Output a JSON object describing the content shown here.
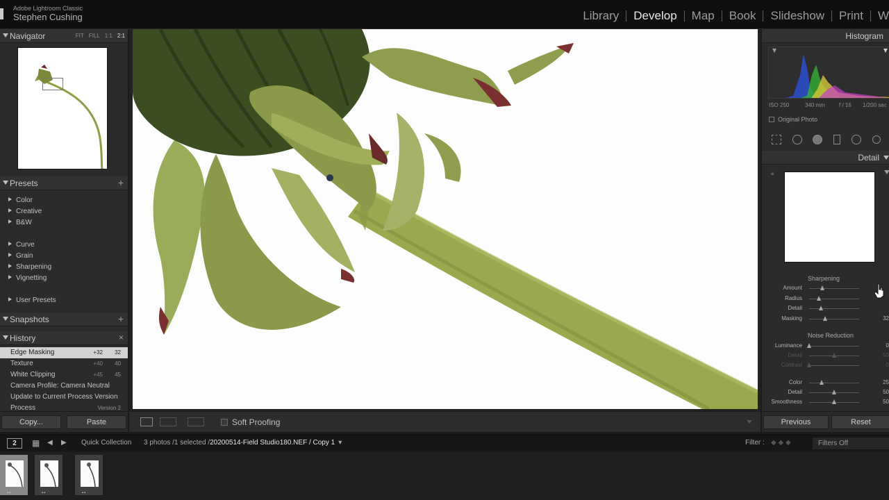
{
  "app": {
    "name": "Adobe Lightroom Classic",
    "user": "Stephen Cushing"
  },
  "modules": [
    {
      "label": "Library",
      "active": false
    },
    {
      "label": "Develop",
      "active": true
    },
    {
      "label": "Map",
      "active": false
    },
    {
      "label": "Book",
      "active": false
    },
    {
      "label": "Slideshow",
      "active": false
    },
    {
      "label": "Print",
      "active": false
    },
    {
      "label": "W",
      "active": false
    }
  ],
  "navigator": {
    "title": "Navigator",
    "zoom": [
      "FIT",
      "FILL",
      "1:1",
      "2:1"
    ],
    "zoom_active": "2:1"
  },
  "presets": {
    "title": "Presets",
    "add": "+",
    "items": [
      "Color",
      "Creative",
      "B&W",
      "Curve",
      "Grain",
      "Sharpening",
      "Vignetting",
      "User Presets"
    ]
  },
  "snapshots": {
    "title": "Snapshots",
    "add": "+"
  },
  "history": {
    "title": "History",
    "close": "×",
    "items": [
      {
        "name": "Edge Masking",
        "delta": "+32",
        "value": "32",
        "selected": true
      },
      {
        "name": "Texture",
        "delta": "+40",
        "value": "40",
        "selected": false
      },
      {
        "name": "White Clipping",
        "delta": "+45",
        "value": "45",
        "selected": false
      },
      {
        "name": "Camera Profile: Camera Neutral",
        "delta": "",
        "value": "",
        "selected": false
      },
      {
        "name": "Update to Current Process Version",
        "delta": "",
        "value": "",
        "selected": false
      },
      {
        "name": "Process",
        "delta": "",
        "value": "Version 2",
        "selected": false
      }
    ]
  },
  "left_buttons": {
    "copy": "Copy...",
    "paste": "Paste"
  },
  "toolbar": {
    "soft_proofing": "Soft Proofing"
  },
  "histogram": {
    "title": "Histogram",
    "exif": {
      "iso": "ISO 250",
      "focal": "340 mm",
      "aperture": "f / 16",
      "shutter": "1/200 sec"
    },
    "original_photo": "Original Photo"
  },
  "detail": {
    "title": "Detail",
    "sharpening": {
      "title": "Sharpening",
      "sliders": [
        {
          "label": "Amount",
          "value": "",
          "pos": 0.26,
          "dim": false
        },
        {
          "label": "Radius",
          "value": "",
          "pos": 0.19,
          "dim": false
        },
        {
          "label": "Detail",
          "value": "",
          "pos": 0.24,
          "dim": false
        },
        {
          "label": "Masking",
          "value": "32",
          "pos": 0.32,
          "dim": false
        }
      ]
    },
    "noise_reduction": {
      "title": "Noise Reduction",
      "sliders": [
        {
          "label": "Luminance",
          "value": "0",
          "pos": 0.0,
          "dim": false
        },
        {
          "label": "Detail",
          "value": "50",
          "pos": 0.5,
          "dim": true
        },
        {
          "label": "Contrast",
          "value": "0",
          "pos": 0.0,
          "dim": true
        },
        {
          "label": "Color",
          "value": "25",
          "pos": 0.25,
          "dim": false
        },
        {
          "label": "Detail",
          "value": "50",
          "pos": 0.5,
          "dim": false
        },
        {
          "label": "Smoothness",
          "value": "50",
          "pos": 0.5,
          "dim": false
        }
      ]
    }
  },
  "right_buttons": {
    "previous": "Previous",
    "reset": "Reset"
  },
  "filmstrip": {
    "monitor": "2",
    "source": "Quick Collection",
    "info_prefix": "3 photos /1 selected /",
    "filename": "20200514-Field Studio180.NEF / Copy 1",
    "filter_label": "Filter :",
    "filter_value": "Filters Off",
    "thumb_count": 3
  },
  "colors": {
    "selected_history_bg": "#d2d2d2",
    "panel_bg": "#2b2b2b",
    "photo_bg": "#fdfdfd",
    "stem": "#9aa84e"
  }
}
